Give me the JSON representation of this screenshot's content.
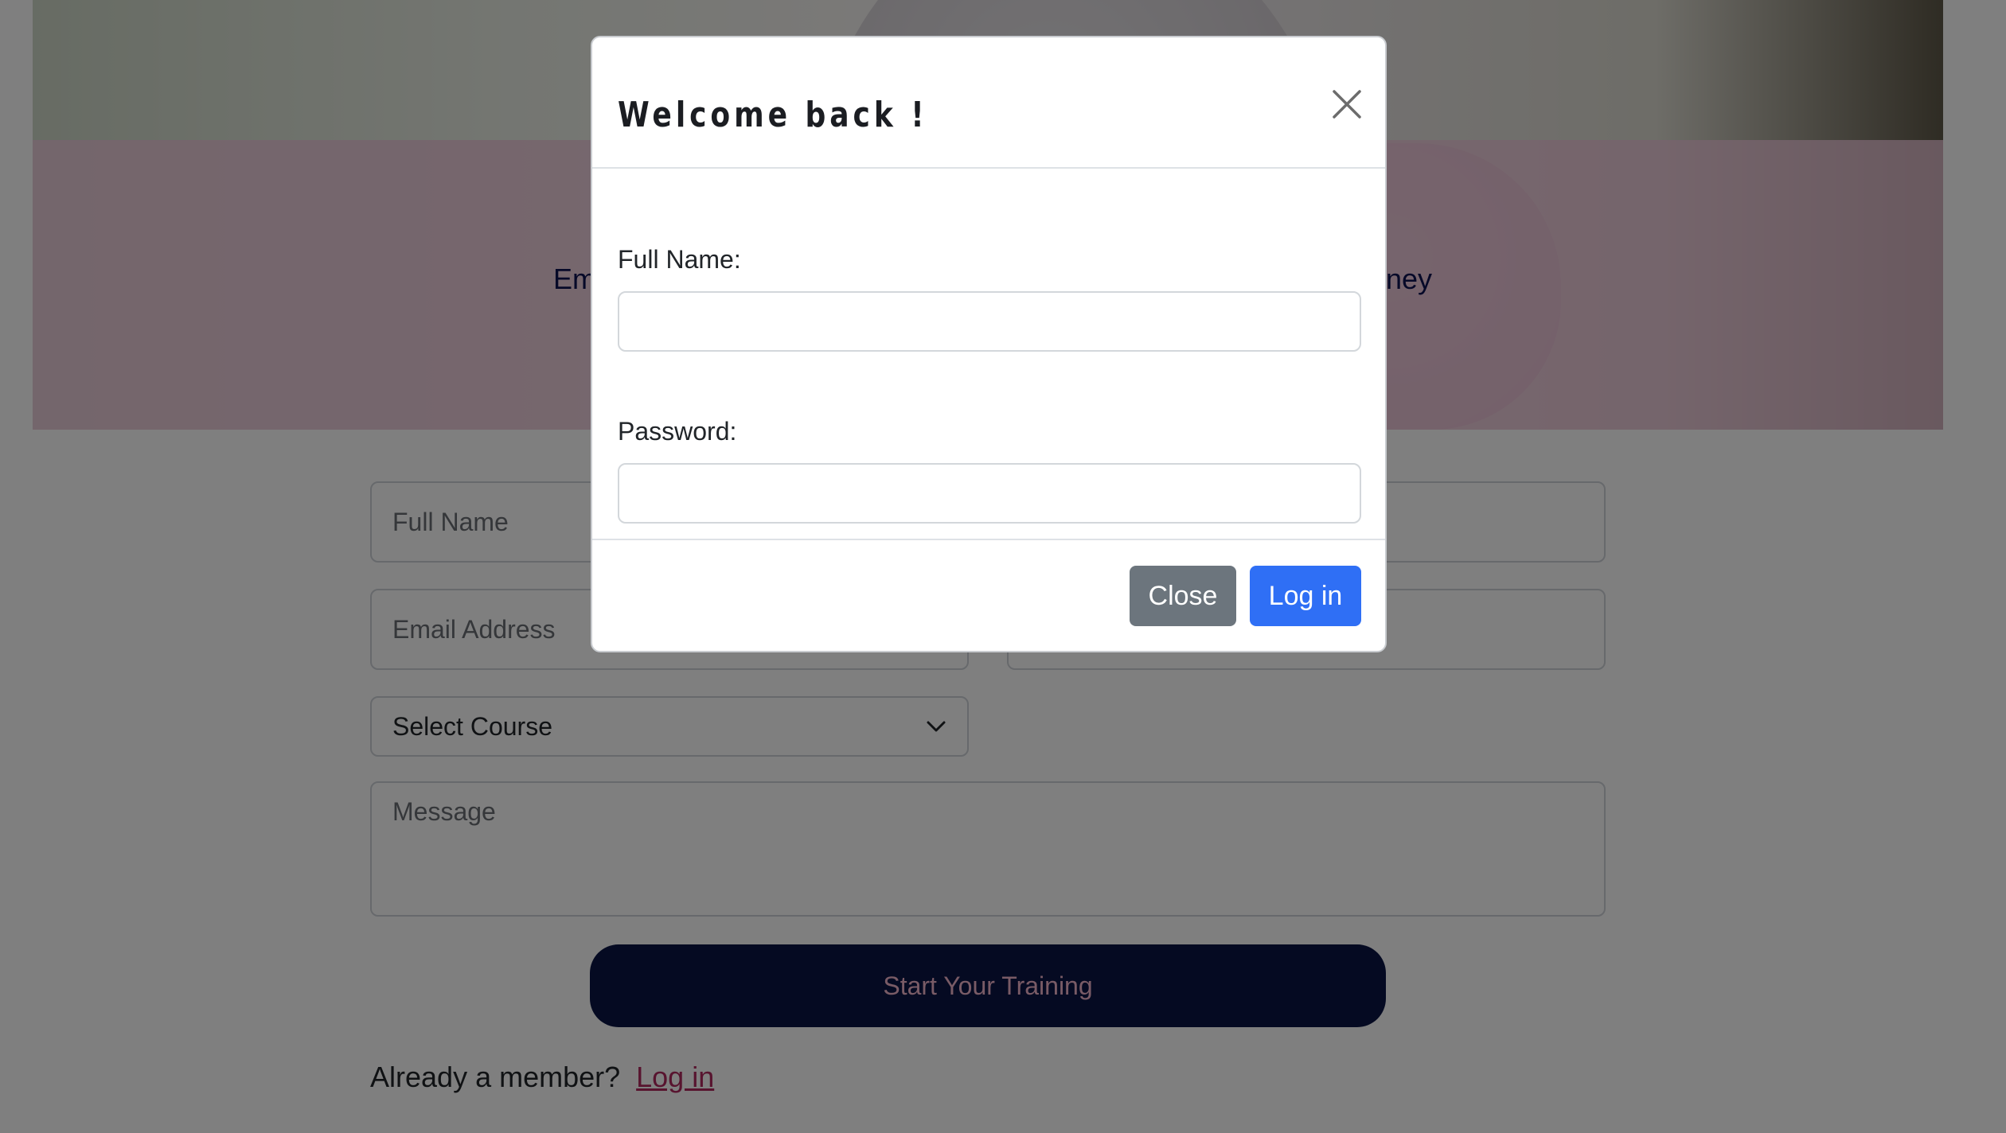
{
  "hero": {
    "text_left": "Em",
    "text_right": "ney"
  },
  "signup_form": {
    "full_name_placeholder": "Full Name",
    "email_placeholder": "Email Address",
    "course_select_value": "Select Course",
    "message_placeholder": "Message",
    "submit_label": "Start Your Training",
    "member_prompt": "Already a member?",
    "login_link": "Log in"
  },
  "modal": {
    "title": "Welcome back !",
    "full_name_label": "Full Name:",
    "full_name_value": "",
    "password_label": "Password:",
    "password_value": "",
    "close_label": "Close",
    "login_label": "Log in"
  },
  "colors": {
    "primary_button": "#2f6ff5",
    "secondary_button": "#6c757d",
    "submit_button": "#0a1545",
    "link": "#b0285e"
  }
}
